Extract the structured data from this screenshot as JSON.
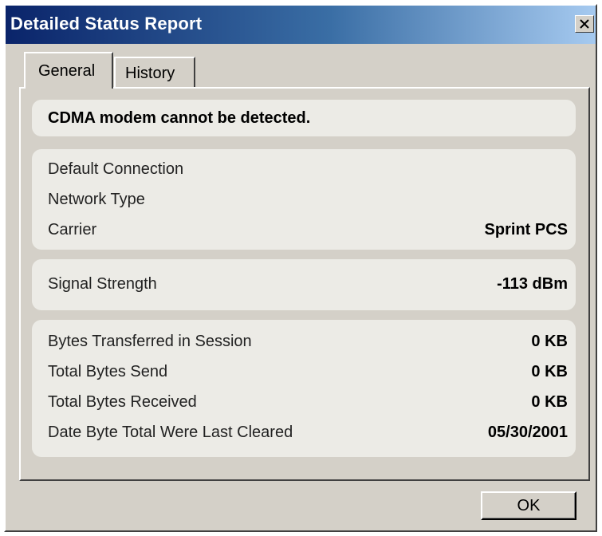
{
  "window": {
    "title": "Detailed Status Report"
  },
  "tabs": [
    {
      "label": "General",
      "active": true
    },
    {
      "label": "History",
      "active": false
    }
  ],
  "status": {
    "message": "CDMA modem cannot be detected."
  },
  "connection": [
    {
      "label": "Default Connection",
      "value": ""
    },
    {
      "label": "Network Type",
      "value": ""
    },
    {
      "label": "Carrier",
      "value": "Sprint PCS"
    }
  ],
  "signal": {
    "label": "Signal Strength",
    "value": "-113 dBm"
  },
  "bytes": [
    {
      "label": "Bytes Transferred in Session",
      "value": "0 KB"
    },
    {
      "label": "Total Bytes Send",
      "value": "0 KB"
    },
    {
      "label": "Total Bytes Received",
      "value": "0 KB"
    },
    {
      "label": "Date Byte Total Were Last Cleared",
      "value": "05/30/2001"
    }
  ],
  "buttons": {
    "ok_label": "OK"
  },
  "icons": {
    "close": "close-icon"
  },
  "colors": {
    "titlebar_start": "#0a246a",
    "titlebar_end": "#a6caf0",
    "face": "#d4d0c8"
  }
}
